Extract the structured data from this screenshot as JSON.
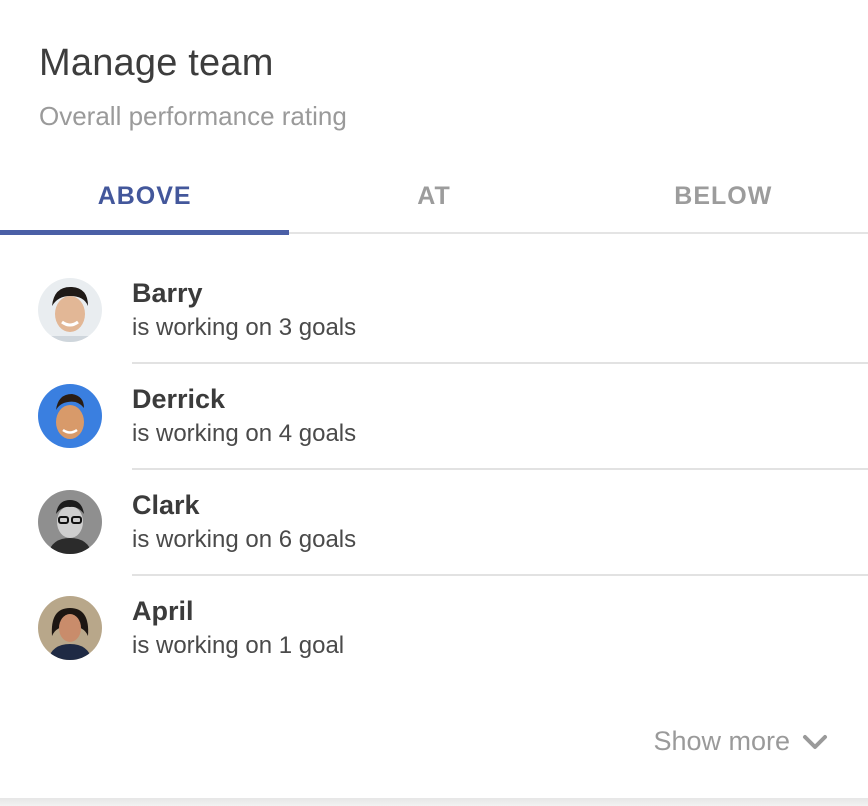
{
  "header": {
    "title": "Manage team",
    "subtitle": "Overall performance rating"
  },
  "tabs": [
    {
      "label": "ABOVE",
      "active": true
    },
    {
      "label": "AT",
      "active": false
    },
    {
      "label": "BELOW",
      "active": false
    }
  ],
  "team": [
    {
      "name": "Barry",
      "detail": "is working on 3 goals"
    },
    {
      "name": "Derrick",
      "detail": "is working on 4 goals"
    },
    {
      "name": "Clark",
      "detail": "is working on 6 goals"
    },
    {
      "name": "April",
      "detail": "is working on 1 goal"
    }
  ],
  "footer": {
    "show_more_label": "Show more",
    "icon": "chevron-down-icon"
  },
  "colors": {
    "accent": "#43579b",
    "tab_inactive": "#9c9c9c",
    "divider": "#e2e2e2"
  }
}
